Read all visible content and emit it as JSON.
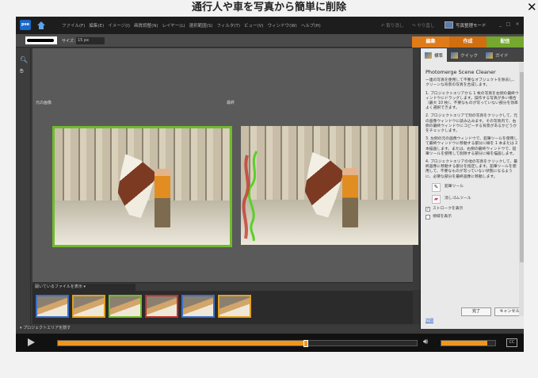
{
  "page_title": "通行人や車を写真から簡単に削除",
  "close_icon": "close-icon",
  "app": {
    "logo": "pse",
    "menus": [
      "ファイル(F)",
      "編集(E)",
      "イメージ(I)",
      "画質調整(N)",
      "レイヤー(L)",
      "選択範囲(S)",
      "フィルタ(T)",
      "ビュー(V)",
      "ウィンドウ(W)",
      "ヘルプ(H)"
    ],
    "undo": "取り消し",
    "redo": "やり直し",
    "organizer": "写真整理モード",
    "window_controls": "_ □ ×"
  },
  "options": {
    "size_label": "サイズ：",
    "size_value": "15 px"
  },
  "modes": {
    "edit": "編集",
    "create": "作成",
    "share": "配信"
  },
  "canvas": {
    "source_label": "元の画像",
    "result_label": "最終"
  },
  "filmstrip": {
    "dropdown": "開いているファイルを表示",
    "thumb_count": 6
  },
  "project_bin": "プロジェクトエリアを隠す",
  "panel": {
    "tabs": [
      "標準",
      "クイック",
      "ガイド"
    ],
    "title": "Photomerge Scene Cleaner",
    "intro": "一連の写真を使用して不要なオブジェクトを除去し、クリーンな背景の写真を合成します。",
    "step1": "1. プロジェクトエリアから 1 枚の写真を右側の最終ウィンドウにドラッグします。操作する写真が多い場合（最大 10 枚）、不要なものが写っていない部分を効率よく選択できます。",
    "step2": "2. プロジェクトエリアで別の写真をクリックして、元の画像ウィンドウに読み込みます。その写真内で、右側の最終ウィンドウにコピーする背景があるかどうかをチェックします。",
    "step3": "3. 左側の元の画像ウィンドウで、鉛筆ツールを使用して最終ウィンドウに移動する部分に線を 1 本または 2 本描画します。または、右側の最終ウィンドウで、鉛筆ツールを使用して削除する部分に線を描画します。",
    "step4": "4. プロジェクトエリアの他の写真をクリックして、最終画像に移動する部分を指定します。鉛筆ツールを使用して、不要なものが写っていない状態になるように、必要な部分を最終画像に移動します。",
    "pencil_tool": "鉛筆ツール",
    "eraser_tool": "消しゴムツール",
    "show_strokes": "ストロークを表示",
    "show_regions": "領域を表示",
    "done_button": "完了",
    "cancel_button": "キャンセル",
    "help_link": "詳細"
  },
  "player": {
    "progress": 0.69,
    "volume": 0.85
  }
}
